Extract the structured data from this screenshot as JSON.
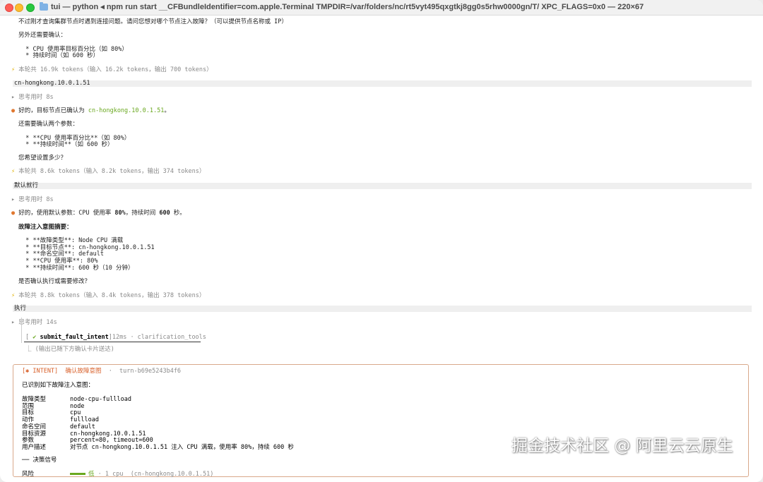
{
  "window": {
    "title": "tui — python ◂ npm run start __CFBundleIdentifier=com.apple.Terminal TMPDIR=/var/folders/nc/rt5vyt495qxgtkj8gg0s5rhw0000gn/T/ XPC_FLAGS=0x0 — 220×67"
  },
  "colors": {
    "accent_orange": "#e07830",
    "green": "#6aa820",
    "bolt": "#e0b000"
  },
  "block1": {
    "l1": "不过刚才查询集群节点时遇到连接问题。请问您想对哪个节点注入故障？（可以提供节点名称或 IP）",
    "l2": "另外还需要确认：",
    "b1": "  * CPU 使用率目标百分比（如 80%）",
    "b2": "  * 持续时间（如 600 秒）",
    "stats": "本轮共 16.9k tokens（输入 16.2k tokens，输出 700 tokens）"
  },
  "prompt1": "cn-hongkong.10.0.1.51",
  "block2": {
    "think": "▸ 思考用时 8s",
    "msg_pre": "好的，目标节点已确认为 ",
    "msg_node": "cn-hongkong.10.0.1.51",
    "msg_post": "。",
    "l2": "还需要确认两个参数：",
    "b1": "  * **CPU 使用率百分比**（如 80%）",
    "b2": "  * **持续时间**（如 600 秒）",
    "l3": "您希望设置多少？",
    "stats": "本轮共 8.6k tokens（输入 8.2k tokens，输出 374 tokens）"
  },
  "prompt2": "默认就行",
  "block3": {
    "think": "▸ 思考用时 8s",
    "msg_pre": "好的，使用默认参数：CPU 使用率 ",
    "msg_cpu": "80%",
    "msg_mid": "，持续时间 ",
    "msg_dur": "600",
    "msg_post": " 秒。",
    "summary": "故障注入意图摘要：",
    "s1": "  * **故障类型**: Node CPU 满载",
    "s2": "  * **目标节点**: cn-hongkong.10.0.1.51",
    "s3": "  * **命名空间**: default",
    "s4": "  * **CPU 使用率**: 80%",
    "s5": "  * **持续时间**: 600 秒（10 分钟）",
    "q": "是否确认执行或需要修改？",
    "stats": "本轮共 8.8k tokens（输入 8.4k tokens，输出 378 tokens）"
  },
  "prompt3": "执行",
  "block4": {
    "think": "▸ 思考用时 14s",
    "tool_check": "✔",
    "tool_name": "submit_fault_intent",
    "tool_meta": "12ms · clarification_tools",
    "tool_result": "⎿ (输出已随下方确认卡片送达)"
  },
  "intent": {
    "tag": "[✱ INTENT]",
    "title": "确认故障意图",
    "turn": "·  turn-b69e5243b4f6",
    "intro": "已识别如下故障注入意图：",
    "rows": [
      {
        "k": "故障类型",
        "v": "node-cpu-fullload"
      },
      {
        "k": "范围",
        "v": "node"
      },
      {
        "k": "目标",
        "v": "cpu"
      },
      {
        "k": "动作",
        "v": "fullload"
      },
      {
        "k": "命名空间",
        "v": "default"
      },
      {
        "k": "目标资源",
        "v": "cn-hongkong.10.0.1.51"
      },
      {
        "k": "参数",
        "v": "percent=80, timeout=600"
      },
      {
        "k": "用户描述",
        "v": "对节点 cn-hongkong.10.0.1.51 注入 CPU 满载，使用率 80%，持续 600 秒"
      }
    ],
    "signals": "── 决策信号",
    "risk_k": "风险",
    "risk_level": "低",
    "risk_rest": " · 1 cpu  (cn-hongkong.10.0.1.51)"
  },
  "watermark": "掘金技术社区 @ 阿里云云原生"
}
